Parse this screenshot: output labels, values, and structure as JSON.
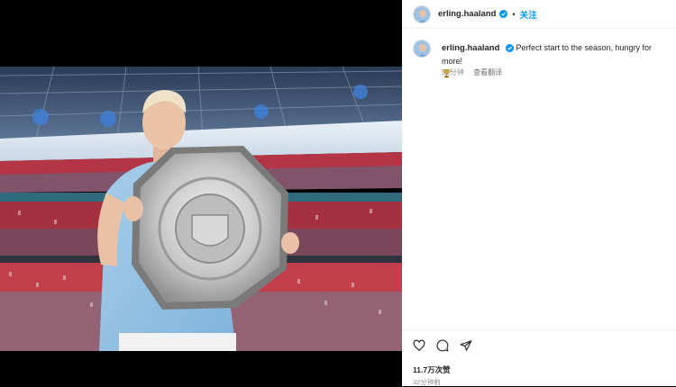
{
  "post": {
    "username": "erling.haaland",
    "follow_label": "关注",
    "separator": "•",
    "caption_text": "Perfect start to the season, hungry for more!",
    "caption_emoji_icon": "trophy-icon",
    "comment_time": "32分钟",
    "translate_label": "查看翻译",
    "likes": "11.7万次赞",
    "post_time": "32分钟前"
  },
  "icons": {
    "verified": "verified-badge-icon",
    "like": "heart-icon",
    "comment": "comment-icon",
    "share": "paper-plane-icon"
  },
  "colors": {
    "accent": "#0095f6",
    "text": "#262626",
    "muted": "#8e8e8e"
  }
}
